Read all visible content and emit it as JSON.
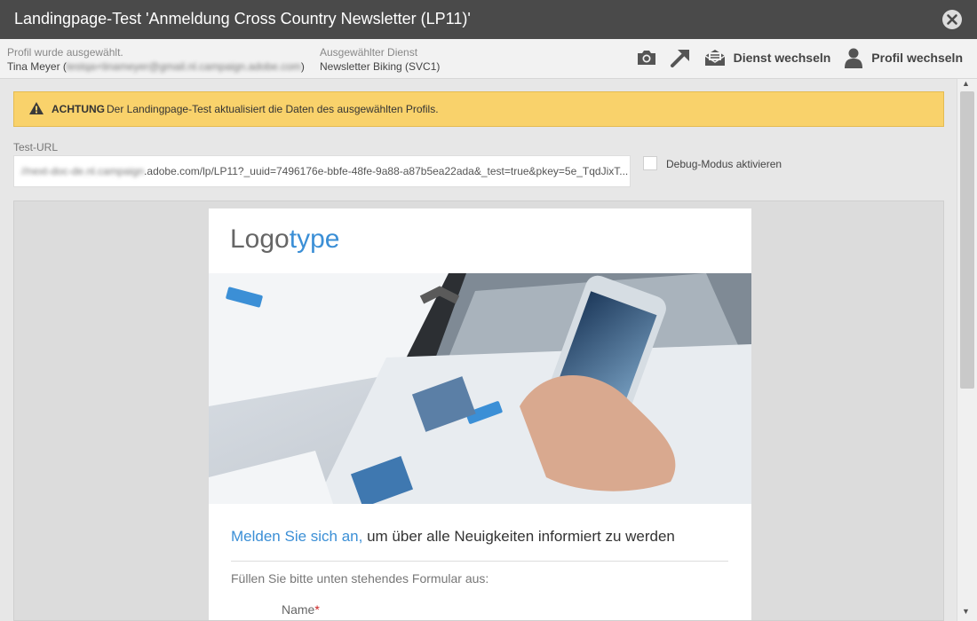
{
  "window": {
    "title": "Landingpage-Test 'Anmeldung Cross Country Newsletter (LP11)'"
  },
  "profile": {
    "label": "Profil wurde ausgewählt.",
    "name": "Tina Meyer",
    "email_open": "(",
    "email": "testqa+tinameyer@gmail.nl.campaign.adobe.com",
    "email_close": ")"
  },
  "service": {
    "label": "Ausgewählter Dienst",
    "value": "Newsletter Biking (SVC1)"
  },
  "toolbar": {
    "screenshot_icon": "camera-icon",
    "open_icon": "arrow-out-icon",
    "change_service_label": "Dienst wechseln",
    "change_profile_label": "Profil wechseln"
  },
  "warning": {
    "title": "ACHTUNG",
    "text": "Der Landingpage-Test aktualisiert die Daten des ausgewählten Profils."
  },
  "test_url": {
    "label": "Test-URL",
    "value_prefix": "//next-doc-de.nl.campaign",
    "value": ".adobe.com/lp/LP11?_uuid=7496176e-bbfe-48fe-9a88-a87b5ea22ada&_test=true&pkey=5e_TqdJixT..."
  },
  "debug": {
    "label": "Debug-Modus aktivieren",
    "checked": false
  },
  "landing": {
    "logo_main": "Logo",
    "logo_accent": "type",
    "headline_blue": "Melden Sie sich an,",
    "headline_rest": " um über alle Neuigkeiten informiert zu werden",
    "form_hint": "Füllen Sie bitte unten stehendes Formular aus:",
    "name_label": "Name",
    "required_mark": "*"
  },
  "colors": {
    "titlebar": "#4a4a4a",
    "warning_bg": "#f9d26b",
    "accent": "#3b8fd6"
  }
}
